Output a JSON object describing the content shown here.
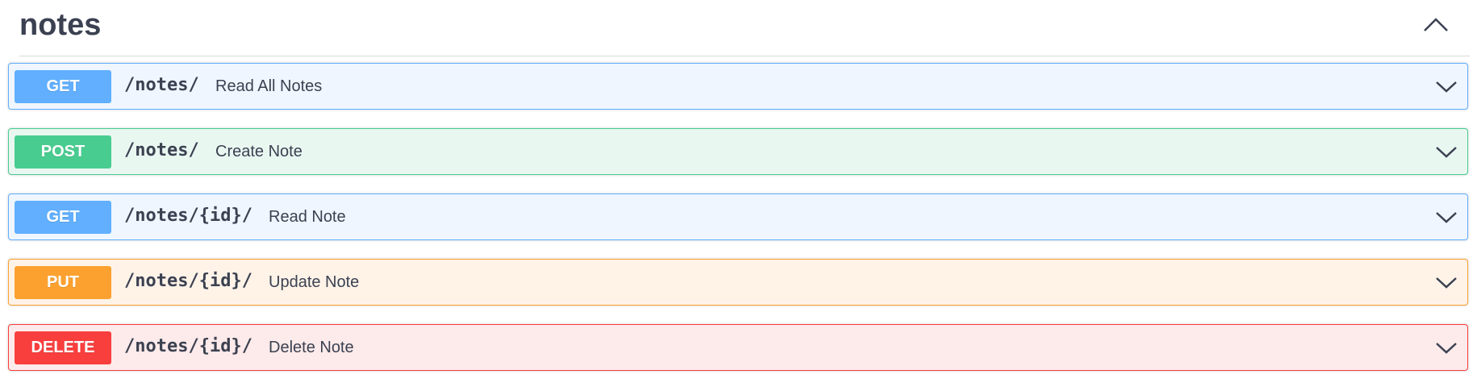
{
  "tag": {
    "title": "notes",
    "toggle_icon": "chevron-up-icon"
  },
  "operations": [
    {
      "method": "GET",
      "path": "/notes/",
      "summary": "Read All Notes",
      "color": "#61affe",
      "bg": "#eff6ff"
    },
    {
      "method": "POST",
      "path": "/notes/",
      "summary": "Create Note",
      "color": "#49cc90",
      "bg": "#e9f7f1"
    },
    {
      "method": "GET",
      "path": "/notes/{id}/",
      "summary": "Read Note",
      "color": "#61affe",
      "bg": "#eff6ff"
    },
    {
      "method": "PUT",
      "path": "/notes/{id}/",
      "summary": "Update Note",
      "color": "#fca130",
      "bg": "#fff3e8"
    },
    {
      "method": "DELETE",
      "path": "/notes/{id}/",
      "summary": "Delete Note",
      "color": "#f93e3e",
      "bg": "#fdeaea"
    }
  ]
}
